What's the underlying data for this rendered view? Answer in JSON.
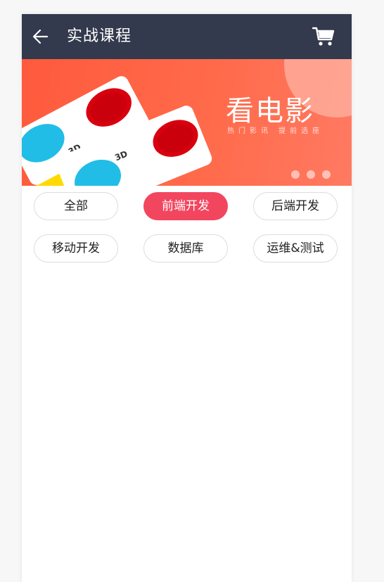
{
  "header": {
    "title": "实战课程",
    "back_icon": "arrow-left-icon",
    "cart_icon": "shopping-cart-icon",
    "background": "#333a4d"
  },
  "banner": {
    "title": "看电影",
    "subtitle": "热门影讯 提前选座",
    "slide_count": 3,
    "colors": {
      "primary": "#ff5a3d",
      "accent_yellow": "#ffd900",
      "accent_blue": "#22bde6",
      "lens_red": "#d9000f"
    }
  },
  "categories": {
    "items": [
      {
        "label": "全部",
        "active": false
      },
      {
        "label": "前端开发",
        "active": true
      },
      {
        "label": "后端开发",
        "active": false
      },
      {
        "label": "移动开发",
        "active": false
      },
      {
        "label": "数据库",
        "active": false
      },
      {
        "label": "运维&测试",
        "active": false
      }
    ],
    "active_color": "#f2465f"
  }
}
